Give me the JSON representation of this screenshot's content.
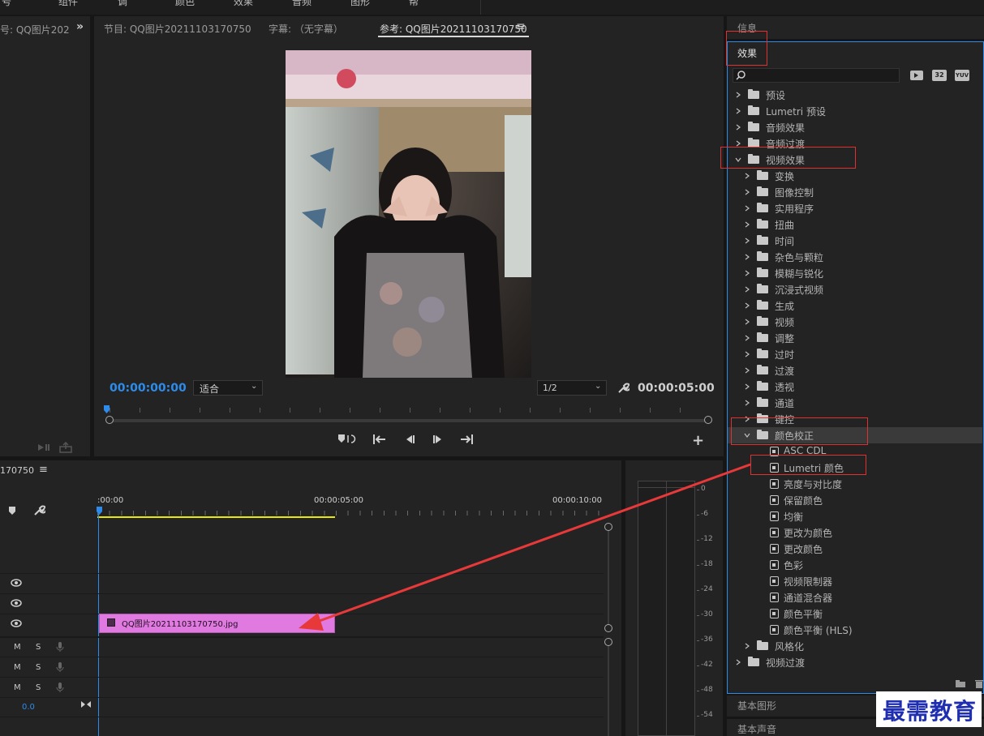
{
  "menu_partial": [
    "号",
    "组件",
    "调",
    "颜色",
    "效果",
    "音频",
    "图形",
    "帮"
  ],
  "source_panel": {
    "title": "号: QQ图片202"
  },
  "program_monitor": {
    "tabs": [
      "节目: QQ图片20211103170750",
      "字幕: （无字幕）",
      "参考: QQ图片20211103170750"
    ],
    "current_time": "00:00:00:00",
    "fit_select": "适合",
    "resolution_select": "1/2",
    "duration": "00:00:05:00"
  },
  "timeline": {
    "sequence_name": "170750",
    "ruler_labels": [
      ":00:00",
      "00:00:05:00",
      "00:00:10:00"
    ],
    "clip_label": "QQ图片20211103170750.jpg",
    "audio_track_buttons": [
      "M",
      "S"
    ],
    "volume_value": "0.0"
  },
  "audio_meter": {
    "scale": [
      "0",
      "-6",
      "-12",
      "-18",
      "-24",
      "-30",
      "-36",
      "-42",
      "-48",
      "-54"
    ]
  },
  "right_panel": {
    "info_tab": "信息",
    "effects_tab": "效果",
    "badge_32": "32",
    "badge_yuv": "YUV",
    "tree": [
      {
        "label": "预设",
        "level": 0,
        "icon": "star-folder",
        "expanded": false
      },
      {
        "label": "Lumetri 预设",
        "level": 0,
        "icon": "star-folder",
        "expanded": false
      },
      {
        "label": "音频效果",
        "level": 0,
        "icon": "folder",
        "expanded": false
      },
      {
        "label": "音频过渡",
        "level": 0,
        "icon": "folder",
        "expanded": false
      },
      {
        "label": "视频效果",
        "level": 0,
        "icon": "folder",
        "expanded": true
      },
      {
        "label": "变换",
        "level": 1,
        "icon": "folder",
        "expanded": false
      },
      {
        "label": "图像控制",
        "level": 1,
        "icon": "folder",
        "expanded": false
      },
      {
        "label": "实用程序",
        "level": 1,
        "icon": "folder",
        "expanded": false
      },
      {
        "label": "扭曲",
        "level": 1,
        "icon": "folder",
        "expanded": false
      },
      {
        "label": "时间",
        "level": 1,
        "icon": "folder",
        "expanded": false
      },
      {
        "label": "杂色与颗粒",
        "level": 1,
        "icon": "folder",
        "expanded": false
      },
      {
        "label": "模糊与锐化",
        "level": 1,
        "icon": "folder",
        "expanded": false
      },
      {
        "label": "沉浸式视频",
        "level": 1,
        "icon": "folder",
        "expanded": false
      },
      {
        "label": "生成",
        "level": 1,
        "icon": "folder",
        "expanded": false
      },
      {
        "label": "视频",
        "level": 1,
        "icon": "folder",
        "expanded": false
      },
      {
        "label": "调整",
        "level": 1,
        "icon": "folder",
        "expanded": false
      },
      {
        "label": "过时",
        "level": 1,
        "icon": "folder",
        "expanded": false
      },
      {
        "label": "过渡",
        "level": 1,
        "icon": "folder",
        "expanded": false
      },
      {
        "label": "透视",
        "level": 1,
        "icon": "folder",
        "expanded": false
      },
      {
        "label": "通道",
        "level": 1,
        "icon": "folder",
        "expanded": false
      },
      {
        "label": "键控",
        "level": 1,
        "icon": "folder",
        "expanded": false
      },
      {
        "label": "颜色校正",
        "level": 1,
        "icon": "folder",
        "expanded": true
      },
      {
        "label": "ASC CDL",
        "level": 2,
        "icon": "fx"
      },
      {
        "label": "Lumetri 颜色",
        "level": 2,
        "icon": "fx"
      },
      {
        "label": "亮度与对比度",
        "level": 2,
        "icon": "fx"
      },
      {
        "label": "保留颜色",
        "level": 2,
        "icon": "fx"
      },
      {
        "label": "均衡",
        "level": 2,
        "icon": "fx"
      },
      {
        "label": "更改为颜色",
        "level": 2,
        "icon": "fx"
      },
      {
        "label": "更改颜色",
        "level": 2,
        "icon": "fx"
      },
      {
        "label": "色彩",
        "level": 2,
        "icon": "fx"
      },
      {
        "label": "视频限制器",
        "level": 2,
        "icon": "fx"
      },
      {
        "label": "通道混合器",
        "level": 2,
        "icon": "fx"
      },
      {
        "label": "颜色平衡",
        "level": 2,
        "icon": "fx"
      },
      {
        "label": "颜色平衡 (HLS)",
        "level": 2,
        "icon": "fx"
      },
      {
        "label": "风格化",
        "level": 1,
        "icon": "folder",
        "expanded": false
      },
      {
        "label": "视频过渡",
        "level": 0,
        "icon": "folder",
        "expanded": false
      }
    ],
    "essential_graphics_tab": "基本图形",
    "essential_sound_tab": "基本声音"
  },
  "watermark": "最需教育",
  "colors": {
    "accent_blue": "#2d8ceb",
    "clip_pink": "#e07ae0",
    "highlight_red": "#e03131",
    "arrow_red": "#e8393a",
    "work_area_yellow": "#e8e800"
  }
}
